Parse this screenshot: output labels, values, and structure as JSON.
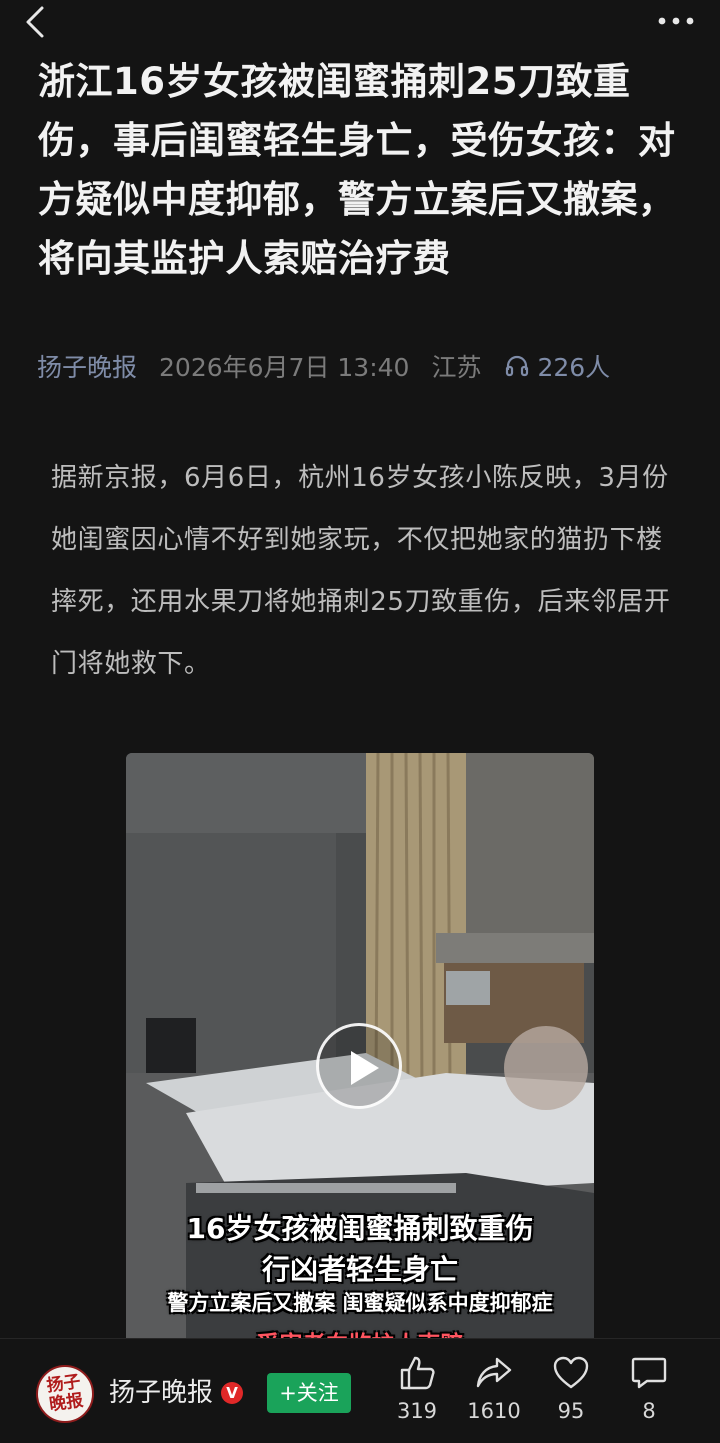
{
  "header": {
    "back_icon": "chevron-left-icon",
    "more_icon": "more-dots-icon"
  },
  "article": {
    "headline": "浙江16岁女孩被闺蜜捅刺25刀致重伤，事后闺蜜轻生身亡，受伤女孩：对方疑似中度抑郁，警方立案后又撤案，将向其监护人索赔治疗费",
    "source": "扬子晚报",
    "date": "2026年6月7日 13:40",
    "region": "江苏",
    "listeners": "226人",
    "body": "据新京报，6月6日，杭州16岁女孩小陈反映，3月份她闺蜜因心情不好到她家玩，不仅把她家的猫扔下楼摔死，还用水果刀将她捅刺25刀致重伤，后来邻居开门将她救下。"
  },
  "video": {
    "caption_line1": "16岁女孩被闺蜜捅刺致重伤",
    "caption_line2": "行凶者轻生身亡",
    "caption_line3": "警方立案后又撤案  闺蜜疑似系中度抑郁症",
    "caption_line4": "受害者向监护人索赔"
  },
  "bottom_bar": {
    "avatar_text": "扬子晚报",
    "author": "扬子晚报",
    "verified_badge": "V",
    "follow_label": "+关注",
    "likes": "319",
    "shares": "1610",
    "favorites": "95",
    "comments": "8"
  },
  "colors": {
    "background": "#141414",
    "follow_green": "#1aa35a",
    "source_blue": "#7f8ca8"
  }
}
